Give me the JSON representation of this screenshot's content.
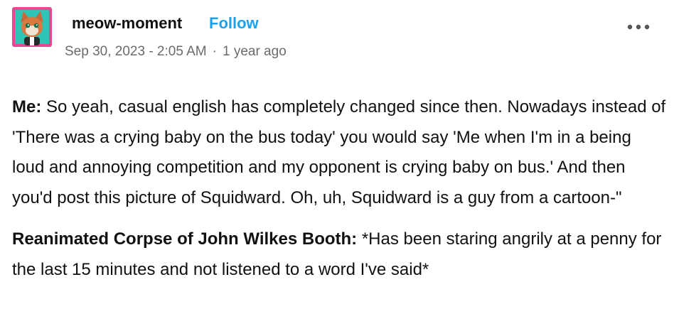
{
  "post": {
    "blog_name": "meow-moment",
    "follow_label": "Follow",
    "date": "Sep 30, 2023 - 2:05 AM",
    "separator": "·",
    "relative_time": "1 year ago",
    "more_icon": "ellipsis-icon",
    "avatar_icon": "avatar-cartoon-fox",
    "colors": {
      "follow": "#1ea0ea",
      "meta": "#6b6b6b",
      "avatar_bg": "#2ec4b6",
      "avatar_border": "#e8488f"
    },
    "paragraphs": [
      {
        "speaker": "Me:",
        "text": " So yeah, casual english has completely changed since then. Nowadays instead of 'There was a crying baby on the bus today' you would say 'Me when I'm in a being loud and annoying competition and my opponent is crying baby on bus.' And then you'd post this picture of Squidward. Oh, uh, Squidward is a guy from a cartoon-\""
      },
      {
        "speaker": "Reanimated Corpse of John Wilkes Booth:",
        "text": " *Has been staring angrily at a penny for the last 15 minutes and not listened to a word I've said*"
      }
    ]
  }
}
